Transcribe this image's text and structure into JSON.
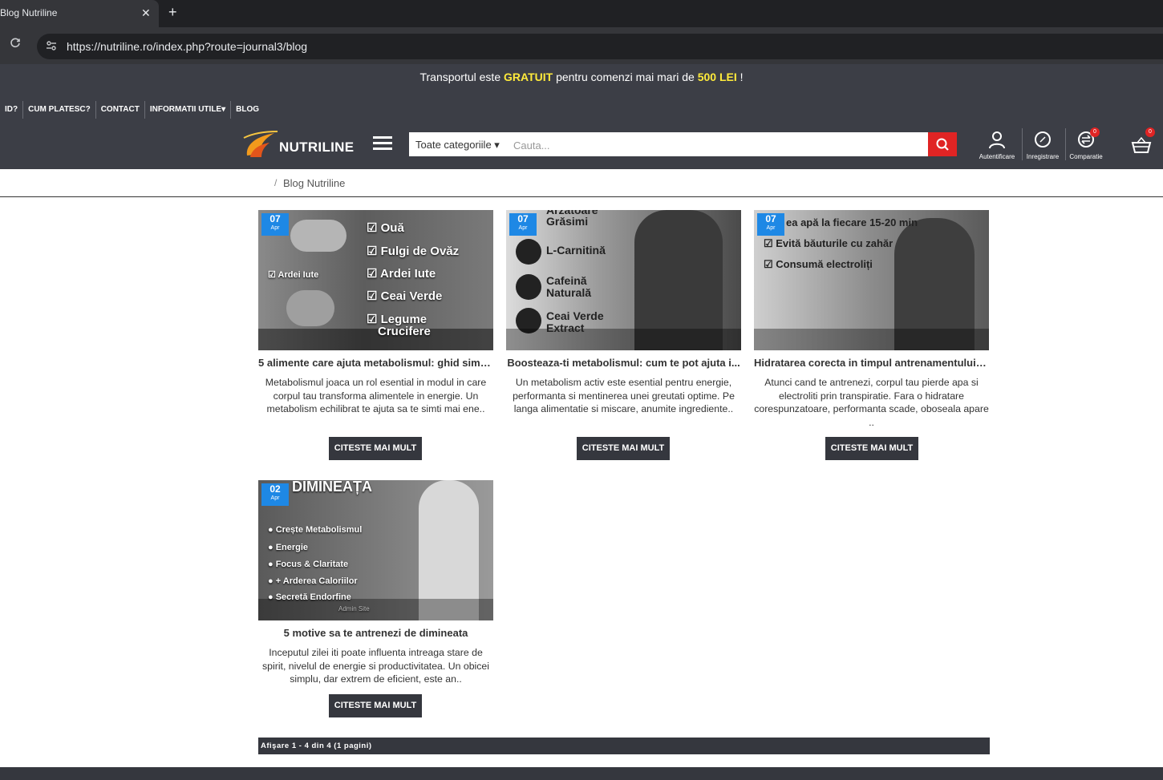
{
  "browser": {
    "tab_title": "Blog Nutriline",
    "tab_close": "✕",
    "new_tab": "+",
    "url": "https://nutriline.ro/index.php?route=journal3/blog"
  },
  "promo": {
    "prefix": "Transportul este ",
    "highlight1": "GRATUIT",
    "middle": " pentru comenzi mai mari de ",
    "highlight2": "500 LEI",
    "suffix": " !"
  },
  "topnav": [
    "ID?",
    "CUM PLATESC?",
    "CONTACT",
    "INFORMATII UTILE▾",
    "BLOG"
  ],
  "logo": {
    "text": "NUTRILINE"
  },
  "search": {
    "category": "Toate categoriile ▾",
    "placeholder": "Cauta..."
  },
  "header_icons": {
    "login": "Autentificare",
    "register": "Inregistrare",
    "compare": "Comparatie",
    "compare_count": "0",
    "cart_count": "0"
  },
  "breadcrumb": {
    "separator": "/",
    "current": "Blog Nutriline"
  },
  "posts": [
    {
      "day": "07",
      "month": "Apr",
      "title": "5 alimente care ajuta metabolismul: ghid simp...",
      "excerpt": "Metabolismul joaca un rol esential in modul in care corpul tau transforma alimentele in energie. Un metabolism echilibrat te ajuta sa te simti mai ene..",
      "button": "CITESTE MAI MULT",
      "image_lines": [
        "☑ Ouă",
        "☑ Fulgi de Ovăz",
        "☑ Ardei Iute",
        "☑ Ceai Verde",
        "☑ Legume",
        "Crucifere",
        "☑ Ardei Iute"
      ]
    },
    {
      "day": "07",
      "month": "Apr",
      "title": "Boosteaza-ti metabolismul: cum te pot ajuta i...",
      "excerpt": "Un metabolism activ este esential pentru energie, performanta si mentinerea unei greutati optime. Pe langa alimentatie si miscare, anumite ingrediente..",
      "button": "CITESTE MAI MULT",
      "image_lines": [
        "Arzătoare",
        "Grăsimi",
        "L-Carnitină",
        "Cafeină",
        "Naturală",
        "Ceai Verde",
        "Extract"
      ]
    },
    {
      "day": "07",
      "month": "Apr",
      "title": "Hidratarea corecta in timpul antrenamentului: ...",
      "excerpt": "Atunci cand te antrenezi, corpul tau pierde apa si electroliti prin transpiratie. Fara o hidratare corespunzatoare, performanta scade, oboseala apare ..",
      "button": "CITESTE MAI MULT",
      "image_lines": [
        "ea apă la fiecare 15-20 min",
        "☑ Evită băuturile cu zahăr",
        "☑ Consumă electroliți"
      ]
    },
    {
      "day": "02",
      "month": "Apr",
      "title": "5 motive sa te antrenezi de dimineata",
      "excerpt": "Inceputul zilei iti poate influenta intreaga stare de spirit, nivelul de energie si productivitatea. Un obicei simplu, dar extrem de eficient, este an..",
      "button": "CITESTE MAI MULT",
      "image_lines": [
        "DIMINEAȚA",
        "● Crește Metabolismul",
        "● Energie",
        "● Focus & Claritate",
        "● + Arderea Caloriilor",
        "● Secretă Endorfine",
        "Admin Site"
      ]
    }
  ],
  "pagination": {
    "text": "Afişare 1 - 4 din 4 (1 pagini)"
  },
  "colors": {
    "header_bg": "#3c3e46",
    "accent_red": "#e02424",
    "date_blue": "#1e88e5",
    "promo_yellow": "#ffeb3b",
    "button_bg": "#35373e"
  }
}
